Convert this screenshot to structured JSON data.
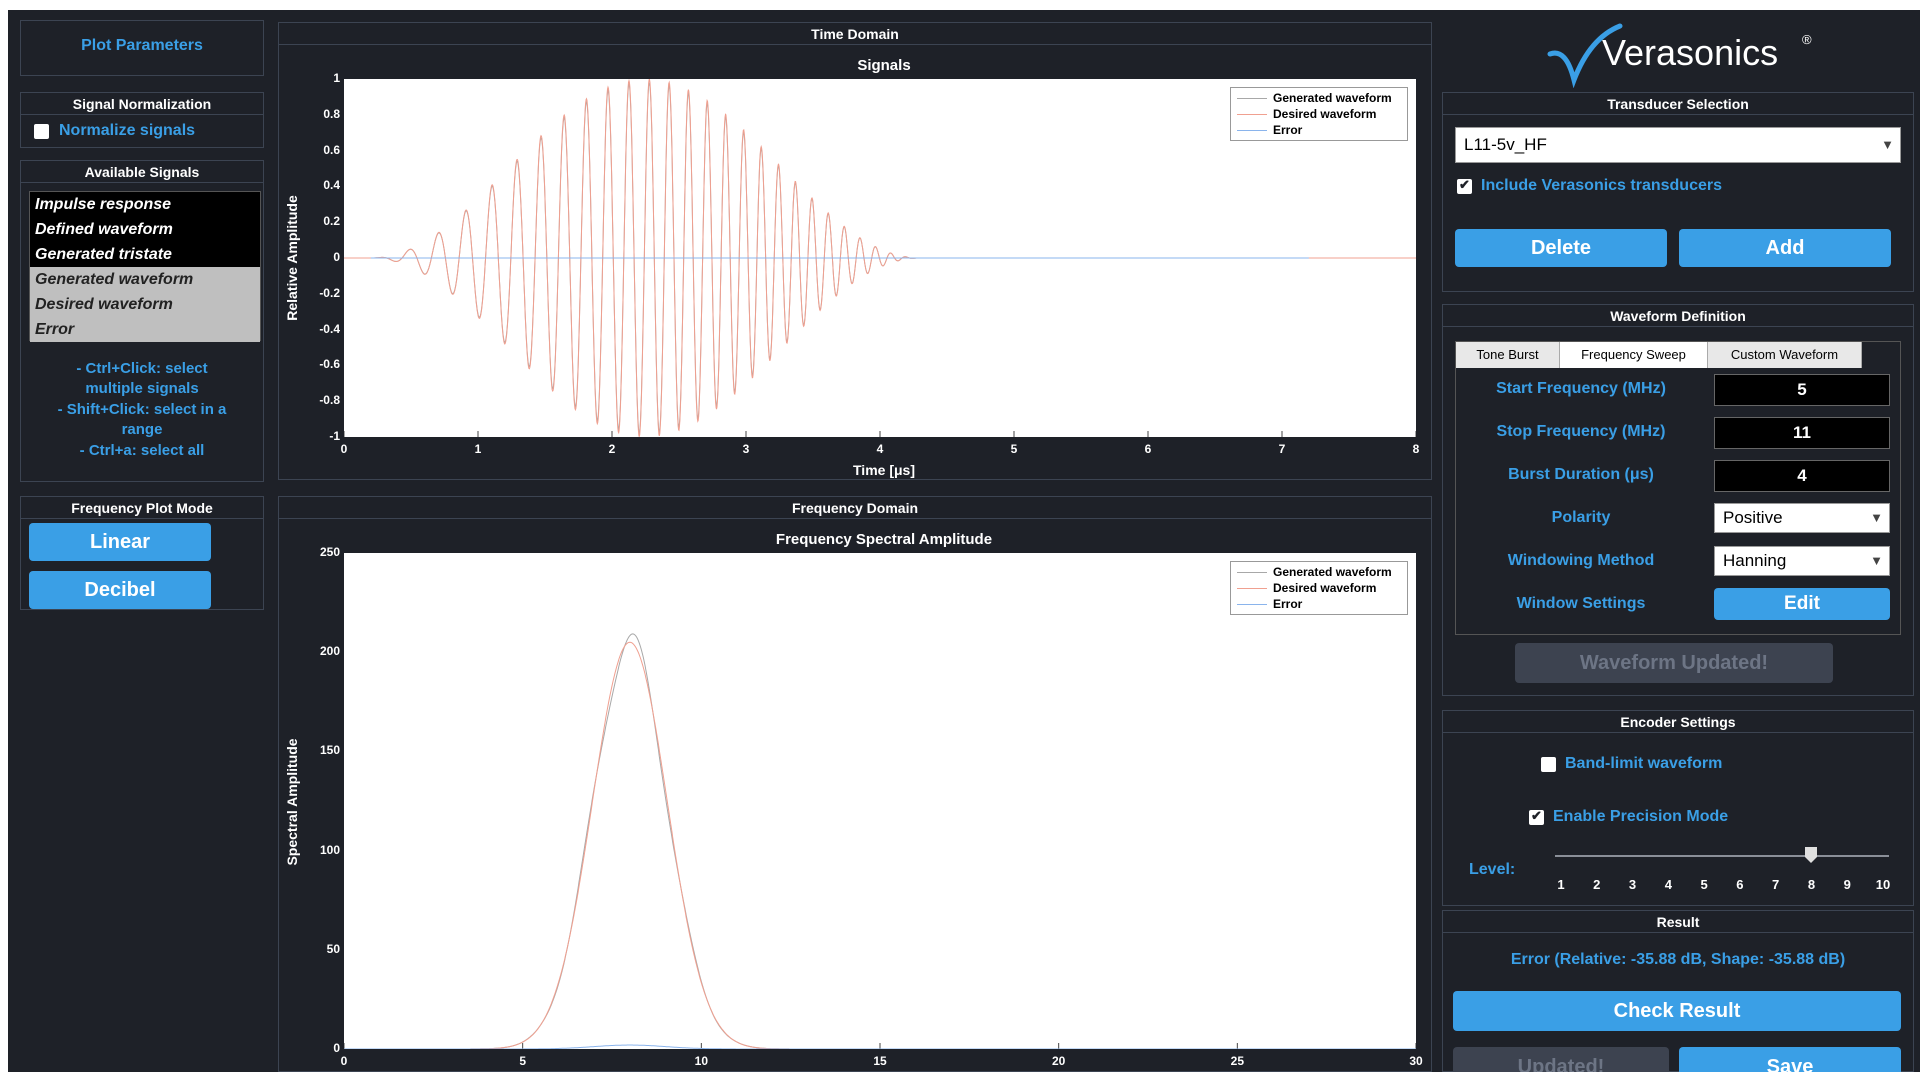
{
  "colors": {
    "accent": "#3a9fe6",
    "background": "#1e2128",
    "generated": "#a8a8a8",
    "desired": "#f0a090",
    "error": "#8ab4ec"
  },
  "left": {
    "plot_parameters_label": "Plot Parameters",
    "signal_normalization": {
      "title": "Signal Normalization",
      "normalize_label": "Normalize signals",
      "normalize_checked": false
    },
    "available_signals": {
      "title": "Available Signals",
      "items": [
        {
          "label": "Impulse response",
          "selected": false
        },
        {
          "label": "Defined waveform",
          "selected": false
        },
        {
          "label": "Generated tristate",
          "selected": false
        },
        {
          "label": "Generated waveform",
          "selected": true
        },
        {
          "label": "Desired waveform",
          "selected": true
        },
        {
          "label": "Error",
          "selected": true
        }
      ],
      "hint_line1": "- Ctrl+Click: select",
      "hint_line2": "multiple signals",
      "hint_line3": "- Shift+Click: select in a",
      "hint_line4": "range",
      "hint_line5": "- Ctrl+a: select all"
    },
    "frequency_plot_mode": {
      "title": "Frequency Plot Mode",
      "linear_label": "Linear",
      "decibel_label": "Decibel"
    }
  },
  "time_domain": {
    "panel_title": "Time Domain",
    "chart_title": "Signals",
    "ylabel": "Relative Amplitude",
    "xlabel": "Time [μs]",
    "yticks": [
      "1",
      "0.8",
      "0.6",
      "0.4",
      "0.2",
      "0",
      "-0.2",
      "-0.4",
      "-0.6",
      "-0.8",
      "-1"
    ],
    "xticks": [
      "0",
      "1",
      "2",
      "3",
      "4",
      "5",
      "6",
      "7",
      "8"
    ],
    "legend": [
      "Generated waveform",
      "Desired waveform",
      "Error"
    ]
  },
  "freq_domain": {
    "panel_title": "Frequency Domain",
    "chart_title": "Frequency Spectral Amplitude",
    "ylabel": "Spectral Amplitude",
    "yticks": [
      "250",
      "200",
      "150",
      "100",
      "50",
      "0"
    ],
    "xticks": [
      "0",
      "5",
      "10",
      "15",
      "20",
      "25",
      "30"
    ],
    "legend": [
      "Generated waveform",
      "Desired waveform",
      "Error"
    ]
  },
  "chart_data": [
    {
      "type": "line",
      "title": "Signals",
      "xlabel": "Time [μs]",
      "ylabel": "Relative Amplitude",
      "xlim": [
        0,
        8
      ],
      "ylim": [
        -1,
        1
      ],
      "grid": false,
      "legend_position": "top-right",
      "series": [
        {
          "name": "Desired waveform",
          "description": "frequency sweep 5→11 MHz burst, Hanning window, peak ≈1 at 2.2 μs, ends ≈4.2 μs",
          "start_us": 0.2,
          "end_us": 4.3,
          "f_start_mhz": 5,
          "f_stop_mhz": 11,
          "peak": 1.0
        },
        {
          "name": "Generated waveform",
          "description": "approximately overlaps desired waveform",
          "start_us": 0.2,
          "end_us": 4.3,
          "peak": 1.0
        },
        {
          "name": "Error",
          "description": "near-zero error line from 0.2 to 7.2 μs",
          "start_us": 0.2,
          "end_us": 7.2,
          "peak": 0.0
        }
      ]
    },
    {
      "type": "line",
      "title": "Frequency Spectral Amplitude",
      "xlabel": "",
      "ylabel": "Spectral Amplitude",
      "xlim": [
        0,
        30
      ],
      "ylim": [
        0,
        250
      ],
      "grid": false,
      "legend_position": "top-right",
      "series": [
        {
          "name": "Generated waveform",
          "peak_freq_mhz": 8,
          "peak_value": 205,
          "sigma_mhz": 1.05
        },
        {
          "name": "Desired waveform",
          "peak_freq_mhz": 8,
          "peak_value": 205,
          "sigma_mhz": 1.05
        },
        {
          "name": "Error",
          "peak_freq_mhz": 8,
          "peak_value": 2,
          "sigma_mhz": 1.0
        }
      ]
    }
  ],
  "right": {
    "logo_text": "Verasonics",
    "logo_reg": "®",
    "transducer": {
      "title": "Transducer Selection",
      "selected": "L11-5v_HF",
      "include_label": "Include Verasonics transducers",
      "include_checked": true,
      "delete_label": "Delete",
      "add_label": "Add"
    },
    "waveform": {
      "title": "Waveform Definition",
      "tabs": [
        "Tone Burst",
        "Frequency Sweep",
        "Custom Waveform"
      ],
      "active_tab": 1,
      "start_freq_label": "Start Frequency (MHz)",
      "start_freq_value": "5",
      "stop_freq_label": "Stop Frequency (MHz)",
      "stop_freq_value": "11",
      "burst_label": "Burst Duration (μs)",
      "burst_value": "4",
      "polarity_label": "Polarity",
      "polarity_value": "Positive",
      "windowing_label": "Windowing Method",
      "windowing_value": "Hanning",
      "window_settings_label": "Window Settings",
      "edit_label": "Edit",
      "updated_label": "Waveform Updated!"
    },
    "encoder": {
      "title": "Encoder Settings",
      "bandlimit_label": "Band-limit waveform",
      "bandlimit_checked": false,
      "precision_label": "Enable Precision Mode",
      "precision_checked": true,
      "level_label": "Level:",
      "level_value": 8,
      "level_min": 1,
      "level_max": 10,
      "level_ticks": [
        "1",
        "2",
        "3",
        "4",
        "5",
        "6",
        "7",
        "8",
        "9",
        "10"
      ]
    },
    "result": {
      "title": "Result",
      "error_text": "Error (Relative: -35.88 dB, Shape: -35.88 dB)",
      "check_label": "Check Result",
      "updated_label": "Updated!",
      "save_label": "Save"
    }
  }
}
